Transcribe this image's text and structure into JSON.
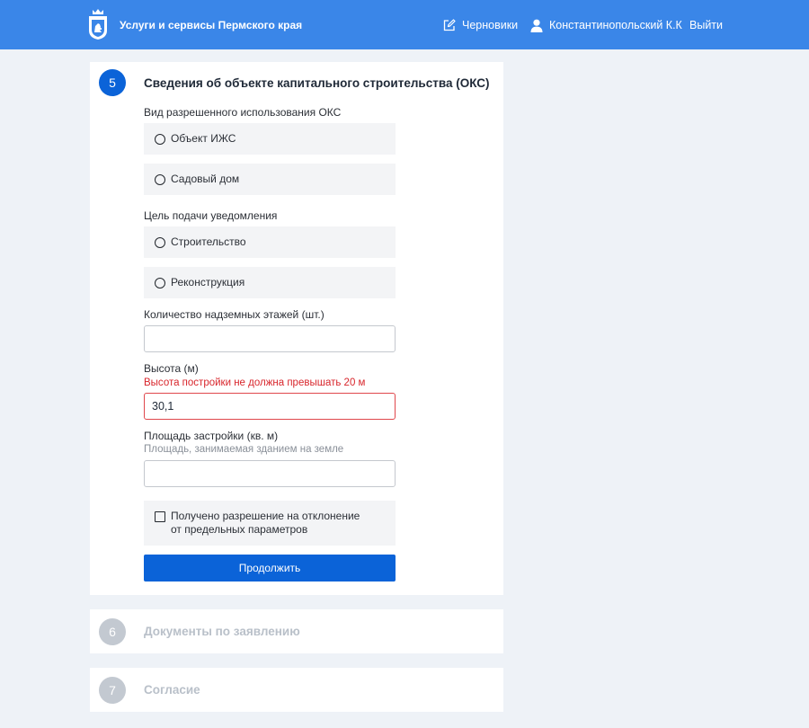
{
  "header": {
    "site_title": "Услуги и сервисы Пермского края",
    "logo_icon": "perm-krai-coat-of-arms-icon",
    "nav": {
      "drafts_label": "Черновики",
      "drafts_icon": "edit-icon",
      "user_label": "Константинопольский К.К",
      "user_icon": "user-icon",
      "logout_label": "Выйти"
    }
  },
  "colors": {
    "header": "#3a86e8",
    "primary": "#0b63d8",
    "error": "#d8262c",
    "inactive_step": "#c3c9d1"
  },
  "step5": {
    "number": "5",
    "title": "Сведения об объекте капитального строительства (ОКС)",
    "usage": {
      "label": "Вид разрешенного использования ОКС",
      "options": [
        "Объект ИЖС",
        "Садовый дом"
      ]
    },
    "purpose": {
      "label": "Цель подачи уведомления",
      "options": [
        "Строительство",
        "Реконструкция"
      ]
    },
    "floors": {
      "label": "Количество надземных этажей (шт.)",
      "value": ""
    },
    "height": {
      "label": "Высота (м)",
      "error": "Высота постройки не должна превышать 20 м",
      "value": "30,1"
    },
    "area": {
      "label": "Площадь застройки (кв. м)",
      "hint": "Площадь, занимаемая зданием на земле",
      "value": ""
    },
    "deviation": {
      "label": "Получено разрешение на отклонение\nот предельных параметров",
      "checked": false
    },
    "continue_label": "Продолжить"
  },
  "step6": {
    "number": "6",
    "title": "Документы по заявлению"
  },
  "step7": {
    "number": "7",
    "title": "Согласие"
  }
}
